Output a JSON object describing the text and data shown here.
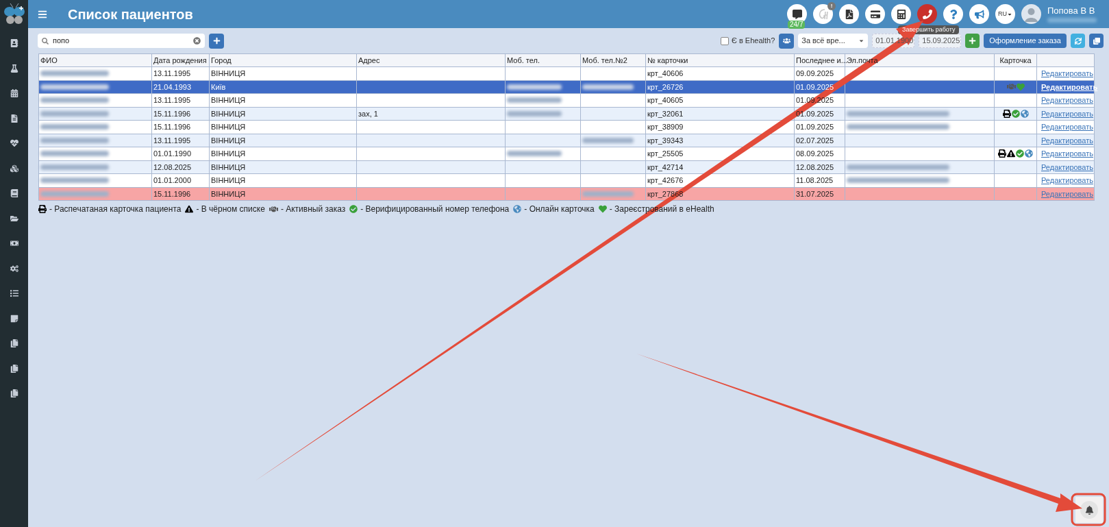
{
  "sidebar": [
    {
      "kind": "contacts"
    },
    {
      "kind": "lab"
    },
    {
      "kind": "calendar"
    },
    {
      "kind": "document"
    },
    {
      "kind": "heartbeat"
    },
    {
      "kind": "cubes"
    },
    {
      "kind": "book"
    },
    {
      "kind": "folder"
    },
    {
      "kind": "money"
    },
    {
      "kind": "gears"
    },
    {
      "kind": "list"
    },
    {
      "kind": "note"
    },
    {
      "kind": "copy"
    },
    {
      "kind": "copy"
    },
    {
      "kind": "copy"
    }
  ],
  "header": {
    "title": "Список пациентов"
  },
  "top_icons": [
    {
      "kind": "chat",
      "badge": "24/7"
    },
    {
      "kind": "ehealth",
      "badge": "!"
    },
    {
      "kind": "pdf"
    },
    {
      "kind": "card"
    },
    {
      "kind": "calculator"
    },
    {
      "kind": "hangup"
    },
    {
      "kind": "help"
    },
    {
      "kind": "megaphone"
    }
  ],
  "language": "RU",
  "user": {
    "name": "Попова В В"
  },
  "tooltip": "Завершить работу",
  "search": {
    "value": "попо"
  },
  "filters": {
    "ehealth_label": "Є в Ehealth?",
    "ehealth_checked": false,
    "period": "За всё вре...",
    "date_from": "01.01.1900",
    "date_to": "15.09.2025",
    "order_button": "Оформление заказа"
  },
  "table": {
    "columns": [
      "ФИО",
      "Дата рождения",
      "Город",
      "Адрес",
      "Моб. тел.",
      "Моб. тел.№2",
      "№ карточки",
      "Последнее и...",
      "Эл.почта",
      "Карточка"
    ],
    "rows": [
      {
        "selected": false,
        "alert": false,
        "birth": "13.11.1995",
        "city": "ВІННИЦЯ",
        "card": "крт_40606",
        "last": "09.09.2025",
        "phone": false,
        "phone2": false,
        "email": false,
        "icons": [],
        "action": "Редактировать"
      },
      {
        "selected": true,
        "alert": false,
        "birth": "21.04.1993",
        "city": "Київ",
        "card": "крт_26726",
        "last": "01.09.2025",
        "phone": true,
        "phone2": true,
        "email": false,
        "icons": [
          {
            "kind": "order"
          },
          {
            "kind": "ehealth"
          }
        ],
        "action": "Редактировать"
      },
      {
        "selected": false,
        "alert": false,
        "birth": "13.11.1995",
        "city": "ВІННИЦЯ",
        "card": "крт_40605",
        "last": "01.09.2025",
        "phone": true,
        "phone2": false,
        "email": false,
        "icons": [],
        "action": "Редактировать"
      },
      {
        "selected": false,
        "alert": false,
        "birth": "15.11.1996",
        "city": "ВІННИЦЯ",
        "address": "зах, 1",
        "card": "крт_32061",
        "last": "01.09.2025",
        "phone": true,
        "phone2": false,
        "email": true,
        "icons": [
          {
            "kind": "printed"
          },
          {
            "kind": "verified"
          },
          {
            "kind": "online"
          }
        ],
        "action": "Редактировать"
      },
      {
        "selected": false,
        "alert": false,
        "birth": "15.11.1996",
        "city": "ВІННИЦЯ",
        "card": "крт_38909",
        "last": "01.09.2025",
        "phone": false,
        "phone2": false,
        "email": true,
        "icons": [],
        "action": "Редактировать"
      },
      {
        "selected": false,
        "alert": false,
        "birth": "13.11.1995",
        "city": "ВІННИЦЯ",
        "card": "крт_39343",
        "last": "02.07.2025",
        "phone": false,
        "phone2": true,
        "email": false,
        "icons": [],
        "action": "Редактировать"
      },
      {
        "selected": false,
        "alert": false,
        "birth": "01.01.1990",
        "city": "ВІННИЦЯ",
        "card": "крт_25505",
        "last": "08.09.2025",
        "phone": true,
        "phone2": false,
        "email": false,
        "icons": [
          {
            "kind": "printed"
          },
          {
            "kind": "blacklist"
          },
          {
            "kind": "verified"
          },
          {
            "kind": "online"
          }
        ],
        "action": "Редактировать"
      },
      {
        "selected": false,
        "alert": false,
        "birth": "12.08.2025",
        "city": "ВІННИЦЯ",
        "card": "крт_42714",
        "last": "12.08.2025",
        "phone": false,
        "phone2": false,
        "email": true,
        "icons": [],
        "action": "Редактировать"
      },
      {
        "selected": false,
        "alert": false,
        "birth": "01.01.2000",
        "city": "ВІННИЦЯ",
        "card": "крт_42676",
        "last": "11.08.2025",
        "phone": false,
        "phone2": false,
        "email": true,
        "icons": [],
        "action": "Редактировать"
      },
      {
        "selected": false,
        "alert": true,
        "birth": "15.11.1996",
        "city": "ВІННИЦЯ",
        "card": "крт_27868",
        "last": "31.07.2025",
        "phone": false,
        "phone2": true,
        "email": false,
        "icons": [],
        "action": "Редактировать"
      }
    ]
  },
  "legend": [
    {
      "kind": "printed",
      "label": "- Распечатаная карточка пациента"
    },
    {
      "kind": "blacklist",
      "label": "- В чёрном списке"
    },
    {
      "kind": "order",
      "label": "- Активный заказ"
    },
    {
      "kind": "verified",
      "label": "- Верифицированный номер телефона"
    },
    {
      "kind": "online",
      "label": "- Онлайн карточка"
    },
    {
      "kind": "ehealth",
      "label": "- Зареєстрований в eHealth"
    }
  ]
}
